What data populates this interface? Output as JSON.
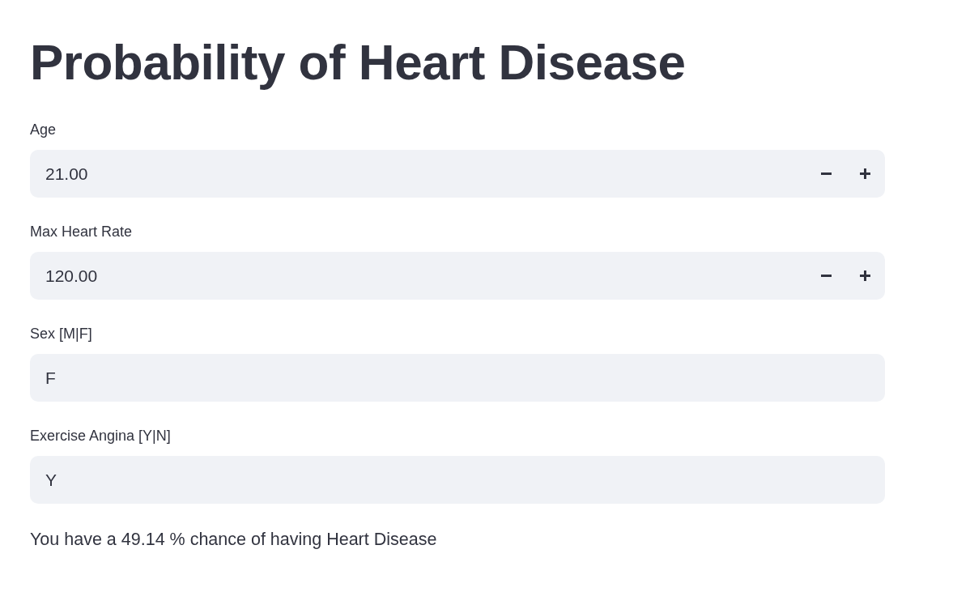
{
  "title": "Probability of Heart Disease",
  "inputs": [
    {
      "kind": "number",
      "label": "Age",
      "value": "21.00"
    },
    {
      "kind": "number",
      "label": "Max Heart Rate",
      "value": "120.00"
    },
    {
      "kind": "text",
      "label": "Sex [M|F]",
      "value": "F"
    },
    {
      "kind": "text",
      "label": "Exercise Angina [Y|N]",
      "value": "Y"
    }
  ],
  "result": "You have a 49.14 % chance of having Heart Disease"
}
